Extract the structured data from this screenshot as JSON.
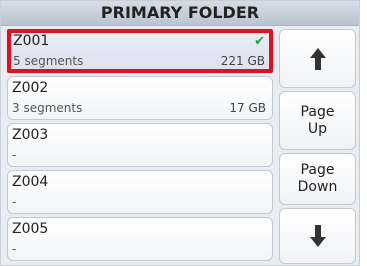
{
  "header": {
    "title": "PRIMARY FOLDER"
  },
  "folders": [
    {
      "name": "Z001",
      "segments": "5 segments",
      "size": "221 GB",
      "selected": true
    },
    {
      "name": "Z002",
      "segments": "3 segments",
      "size": "17 GB"
    },
    {
      "name": "Z003",
      "segments": "-",
      "size": ""
    },
    {
      "name": "Z004",
      "segments": "-",
      "size": ""
    },
    {
      "name": "Z005",
      "segments": "-",
      "size": ""
    }
  ],
  "nav": {
    "up_icon": "arrow-up-icon",
    "page_up_label": "Page Up",
    "page_down_label": "Page Down",
    "down_icon": "arrow-down-icon"
  },
  "colors": {
    "selection_border": "#e0101f",
    "check": "#2aa040"
  },
  "icons": {
    "selected_marker": "checkmark-icon"
  }
}
